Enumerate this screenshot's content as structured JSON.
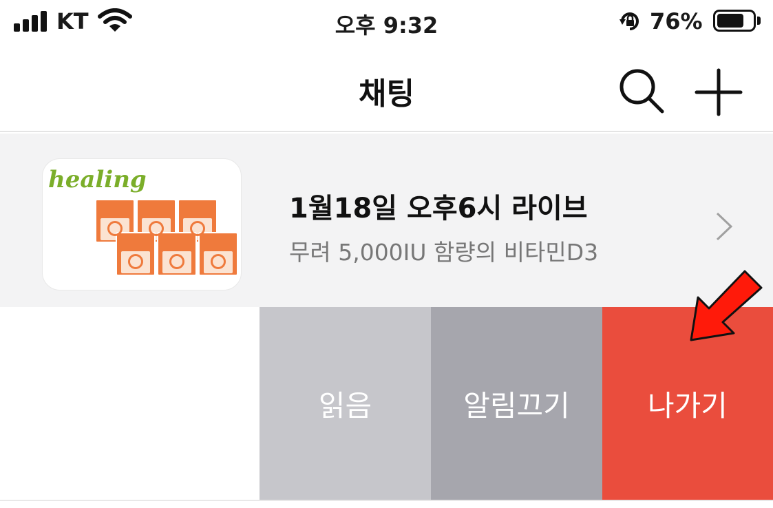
{
  "status_bar": {
    "carrier": "KT",
    "time": "오후 9:32",
    "battery_percent": "76%",
    "battery_level": 0.76,
    "icons": [
      "signal-bars-icon",
      "wifi-icon",
      "rotation-lock-icon",
      "battery-icon"
    ]
  },
  "nav": {
    "title": "채팅",
    "search_icon": "search-icon",
    "add_icon": "plus-icon"
  },
  "chat_item": {
    "thumbnail_brand": "healing",
    "title": "1월18일 오후6시 라이브",
    "subtitle": "무려 5,000IU 함량의 비타민D3",
    "chevron_icon": "chevron-right-icon"
  },
  "swipe_actions": {
    "read": "읽음",
    "mute": "알림끄기",
    "leave": "나가기"
  },
  "colors": {
    "read_bg": "#c6c6cb",
    "mute_bg": "#a6a6ad",
    "leave_bg": "#ea4d3d",
    "row_bg": "#f3f3f4",
    "arrow": "#ff0000"
  }
}
